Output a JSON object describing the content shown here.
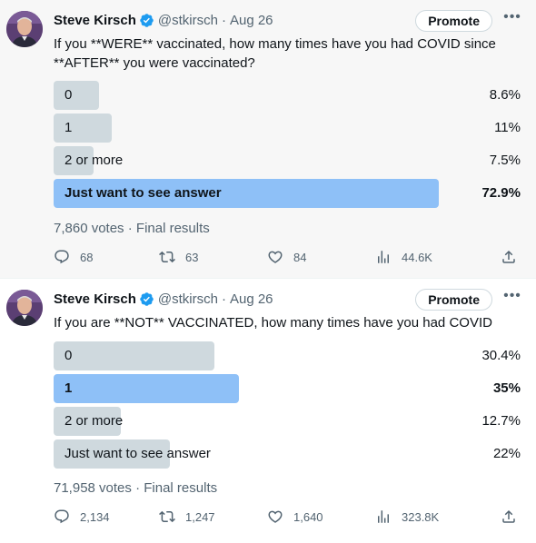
{
  "tweets": [
    {
      "author": {
        "name": "Steve Kirsch",
        "handle": "@stkirsch",
        "date": "Aug 26"
      },
      "promote_label": "Promote",
      "text": "If you **WERE** vaccinated, how many times have you had COVID since **AFTER** you were vaccinated?",
      "poll": {
        "options": [
          {
            "label": "0",
            "percent_text": "8.6%",
            "percent": 8.6,
            "winner": false
          },
          {
            "label": "1",
            "percent_text": "11%",
            "percent": 11,
            "winner": false
          },
          {
            "label": "2 or more",
            "percent_text": "7.5%",
            "percent": 7.5,
            "winner": false
          },
          {
            "label": "Just want to see answer",
            "percent_text": "72.9%",
            "percent": 72.9,
            "winner": true
          }
        ],
        "votes": "7,860 votes",
        "status": "Final results"
      },
      "stats": {
        "replies": "68",
        "retweets": "63",
        "likes": "84",
        "views": "44.6K"
      }
    },
    {
      "author": {
        "name": "Steve Kirsch",
        "handle": "@stkirsch",
        "date": "Aug 26"
      },
      "promote_label": "Promote",
      "text": "If you are **NOT** VACCINATED, how many times have you had COVID",
      "poll": {
        "options": [
          {
            "label": "0",
            "percent_text": "30.4%",
            "percent": 30.4,
            "winner": false
          },
          {
            "label": "1",
            "percent_text": "35%",
            "percent": 35,
            "winner": true
          },
          {
            "label": "2 or more",
            "percent_text": "12.7%",
            "percent": 12.7,
            "winner": false
          },
          {
            "label": "Just want to see answer",
            "percent_text": "22%",
            "percent": 22,
            "winner": false
          }
        ],
        "votes": "71,958 votes",
        "status": "Final results"
      },
      "stats": {
        "replies": "2,134",
        "retweets": "1,247",
        "likes": "1,640",
        "views": "323.8K"
      }
    }
  ],
  "icons": {
    "verified": "verified-badge-icon",
    "more": "more-icon",
    "reply": "reply-icon",
    "retweet": "retweet-icon",
    "like": "heart-icon",
    "views": "views-icon",
    "share": "share-icon"
  },
  "colors": {
    "poll_bar": "#cfd9de",
    "poll_bar_winner": "#8ec0f7",
    "verified": "#1d9bf0",
    "muted_text": "#536471"
  }
}
